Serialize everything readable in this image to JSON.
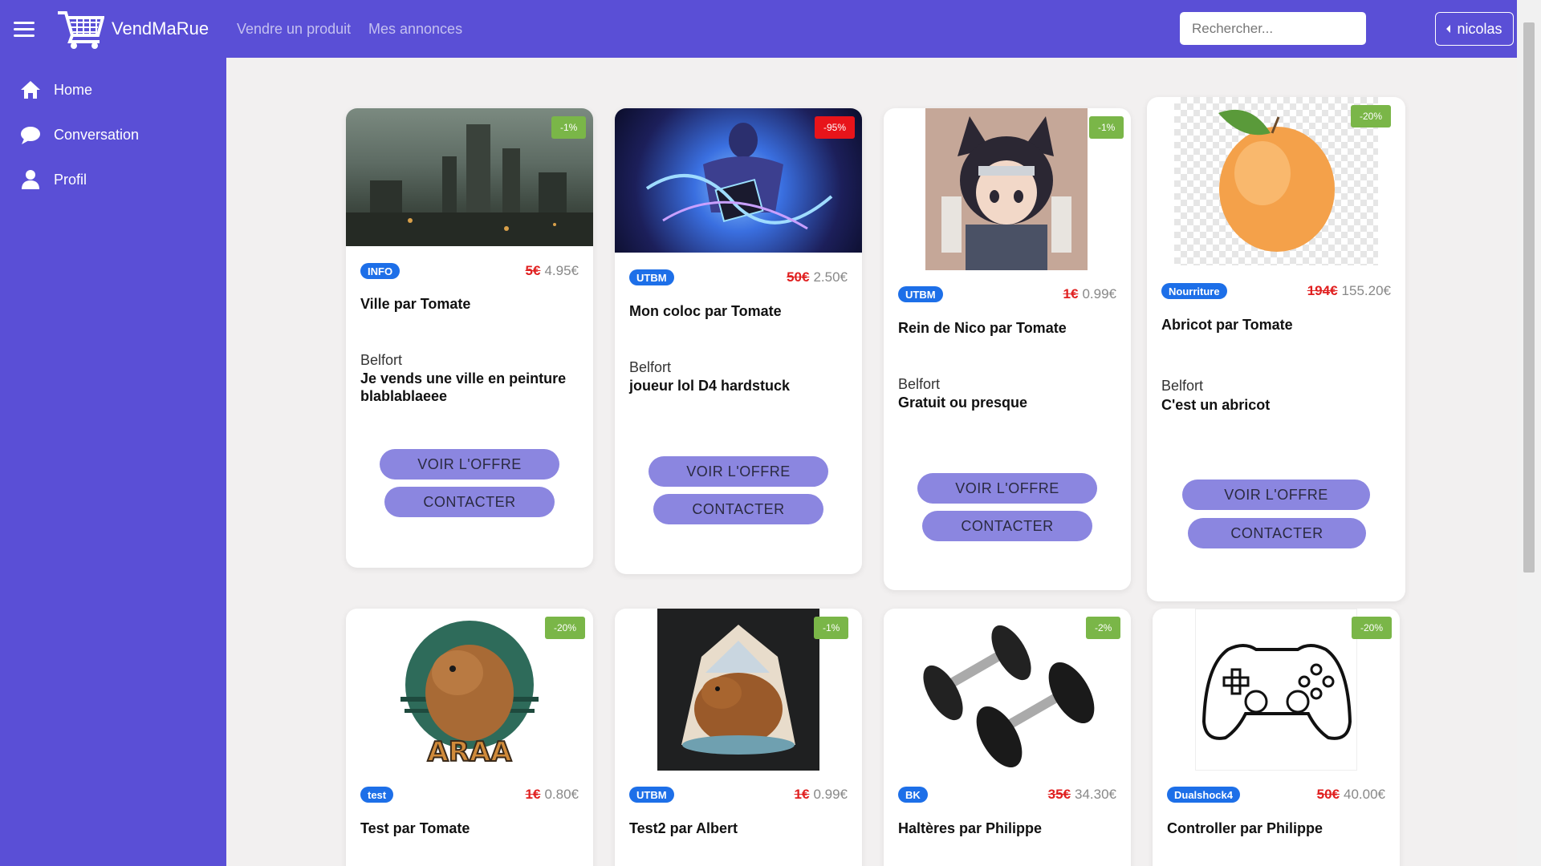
{
  "header": {
    "brand": "VendMaRue",
    "nav": [
      "Vendre un produit",
      "Mes annonces"
    ],
    "search_placeholder": "Rechercher...",
    "user": "nicolas"
  },
  "sidebar": {
    "items": [
      {
        "label": "Home",
        "icon": "home-icon"
      },
      {
        "label": "Conversation",
        "icon": "chat-icon"
      },
      {
        "label": "Profil",
        "icon": "user-icon"
      }
    ]
  },
  "colors": {
    "accent": "#5a4fd6",
    "button": "#8b86e0",
    "badge": "#1d6fe8",
    "discount_green": "#7ab648",
    "discount_red": "#e8141a",
    "old_price": "#e02020"
  },
  "buttons": {
    "view": "VOIR L'OFFRE",
    "contact": "CONTACTER"
  },
  "cards": [
    {
      "discount": "-1%",
      "tag": "INFO",
      "old_price": "5€",
      "price": "4.95€",
      "title": "Ville par Tomate",
      "city": "Belfort",
      "desc": "Je vends une ville en peinture blablablaeee",
      "image": "city-painting"
    },
    {
      "discount": "-95%",
      "tag": "UTBM",
      "old_price": "50€",
      "price": "2.50€",
      "title": "Mon coloc par Tomate",
      "city": "Belfort",
      "desc": "joueur lol D4 hardstuck",
      "image": "fantasy-mage"
    },
    {
      "discount": "-1%",
      "tag": "UTBM",
      "old_price": "1€",
      "price": "0.99€",
      "title": "Rein de Nico par Tomate",
      "city": "Belfort",
      "desc": "Gratuit ou presque",
      "image": "anime-character"
    },
    {
      "discount": "-20%",
      "tag": "Nourriture",
      "old_price": "194€",
      "price": "155.20€",
      "title": "Abricot par Tomate",
      "city": "Belfort",
      "desc": "C'est un abricot",
      "image": "apricot"
    },
    {
      "discount": "-20%",
      "tag": "test",
      "old_price": "1€",
      "price": "0.80€",
      "title": "Test par Tomate",
      "image": "capybara-logo",
      "logo_text": "ARAA"
    },
    {
      "discount": "-1%",
      "tag": "UTBM",
      "old_price": "1€",
      "price": "0.99€",
      "title": "Test2 par Albert",
      "image": "capybara-dark"
    },
    {
      "discount": "-2%",
      "tag": "BK",
      "old_price": "35€",
      "price": "34.30€",
      "title": "Haltères par Philippe",
      "image": "dumbbells"
    },
    {
      "discount": "-20%",
      "tag": "Dualshock4",
      "old_price": "50€",
      "price": "40.00€",
      "title": "Controller par Philippe",
      "image": "gamepad"
    }
  ]
}
